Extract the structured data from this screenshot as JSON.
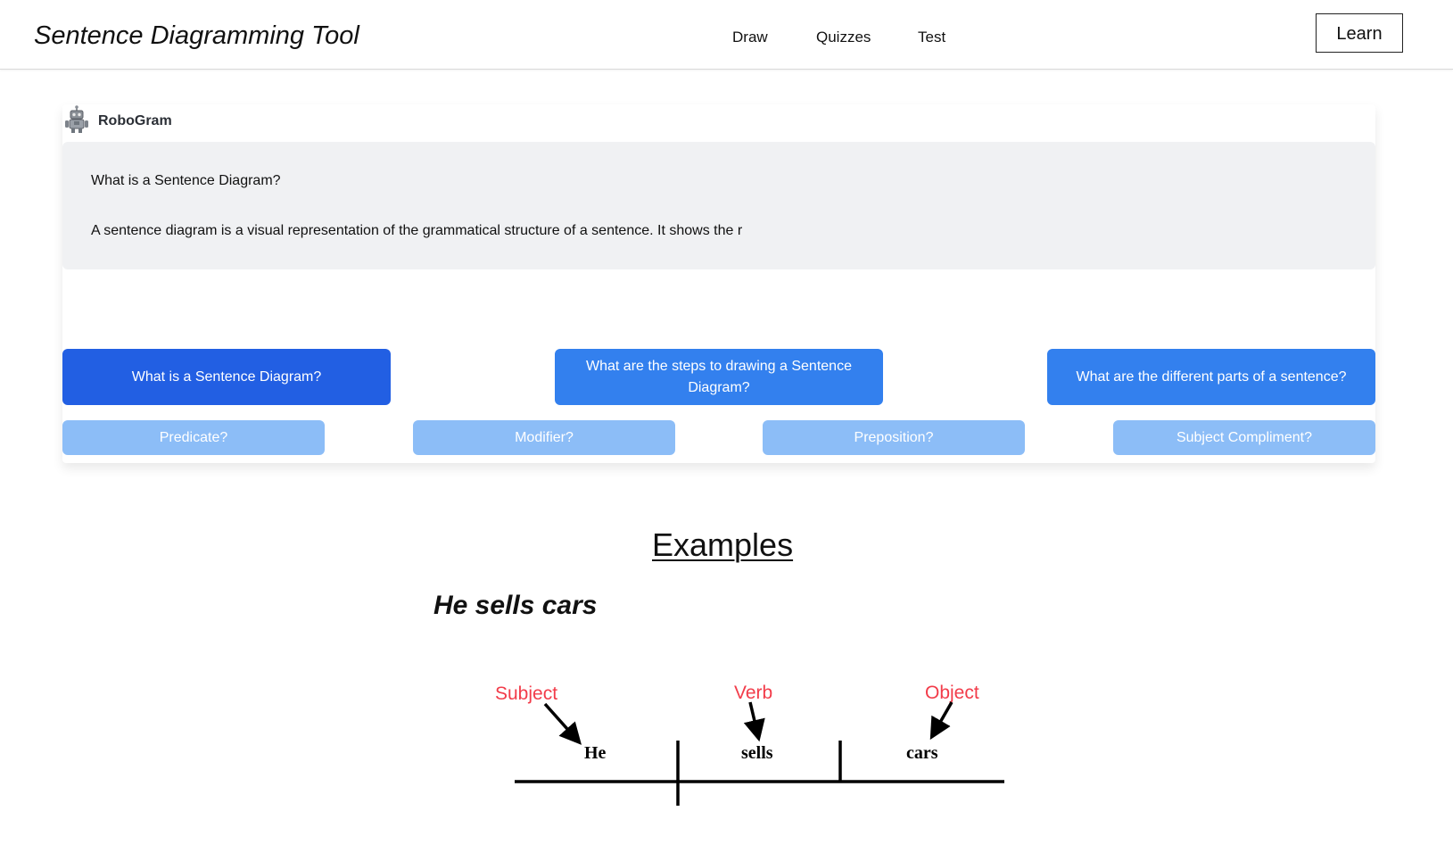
{
  "header": {
    "app_title": "Sentence Diagramming Tool",
    "nav": [
      "Draw",
      "Quizzes",
      "Test"
    ],
    "learn_label": "Learn"
  },
  "chat": {
    "bot_name": "RoboGram",
    "bot_icon": "robot-icon",
    "message": {
      "question": "What is a Sentence Diagram?",
      "answer": "A sentence diagram is a visual representation of the grammatical structure of a sentence. It shows the r"
    },
    "topics": [
      "What is a Sentence Diagram?",
      "What are the steps to drawing a Sentence Diagram?",
      "What are the different parts of a sentence?"
    ],
    "active_topic_index": 0,
    "subtopics": [
      "Predicate?",
      "Modifier?",
      "Preposition?",
      "Subject Compliment?"
    ]
  },
  "examples": {
    "heading": "Examples",
    "sentence": "He sells cars",
    "diagram": {
      "words": [
        "He",
        "sells",
        "cars"
      ],
      "labels": [
        "Subject",
        "Verb",
        "Object"
      ],
      "label_color": "#f23c4a"
    }
  },
  "colors": {
    "topic_active": "#225fe3",
    "topic": "#3380ee",
    "subtopic": "#8cbdf7",
    "message_bg": "#f0f1f3"
  }
}
